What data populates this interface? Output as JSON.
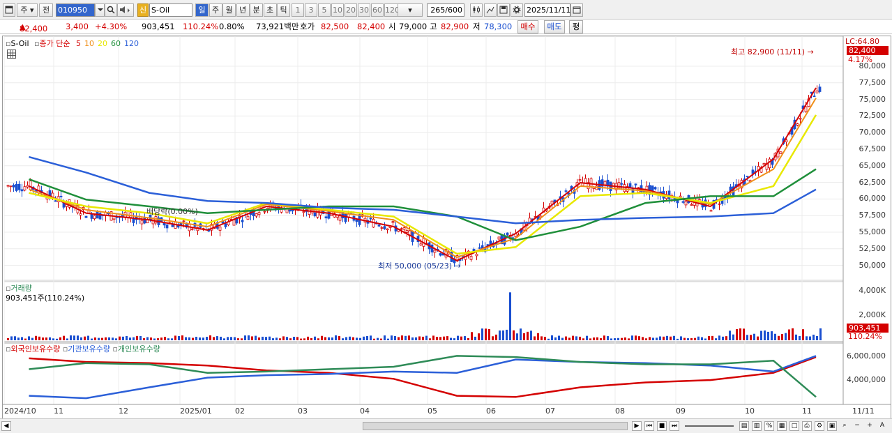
{
  "toolbar": {
    "period_type": "주",
    "prev_label": "전",
    "code": "010950",
    "tag_new": "신",
    "stock_name": "S-Oil",
    "periods": [
      "일",
      "주",
      "월",
      "년",
      "분",
      "초",
      "틱"
    ],
    "active_period": "일",
    "intervals": [
      "1",
      "3",
      "5",
      "10",
      "20",
      "30",
      "60",
      "120"
    ],
    "count": "265",
    "count_max": "/600",
    "date": "2025/11/11"
  },
  "quote": {
    "price": "82,400",
    "change": "3,400",
    "change_pct": "+4.30%",
    "volume": "903,451",
    "volume_ratio": "110.24%",
    "turnover": "0.80%",
    "amount": "73,921백만",
    "bid_label": "호가",
    "bid1": "82,500",
    "bid2": "82,400",
    "open_label": "시",
    "open": "79,000",
    "high_label": "고",
    "high": "82,900",
    "low_label": "저",
    "low": "78,300",
    "buy": "매수",
    "sell": "매도",
    "eval": "평"
  },
  "legend": {
    "name": "S-Oil",
    "close_label": "종가 단순",
    "ma": [
      "5",
      "10",
      "20",
      "60",
      "120"
    ],
    "ma_colors": [
      "#d40000",
      "#f0901a",
      "#e8e800",
      "#1f8f3a",
      "#2b5fd8"
    ]
  },
  "annotations": {
    "high_note": "최고 82,900 (11/11)",
    "low_note": "최저 50,000 (05/23)",
    "dividend_note": "배당락(0.00%)",
    "lc": "LC:64.80",
    "last_price": "82,400",
    "last_pct": "4.17%"
  },
  "volume_panel": {
    "title": "거래량",
    "summary": "903,451주(110.24%)",
    "last": "903,451",
    "last_pct": "110.24%",
    "axis": [
      "4,000K",
      "2,000K"
    ]
  },
  "flow_panel": {
    "labels": [
      "외국인보유수량",
      "기관보유수량",
      "개인보유수량"
    ],
    "colors": [
      "#d40000",
      "#2b5fd8",
      "#2e8b57"
    ],
    "axis": [
      "6,000,000",
      "4,000,000"
    ]
  },
  "price_axis": [
    "80,000",
    "77,500",
    "75,000",
    "72,500",
    "70,000",
    "67,500",
    "65,000",
    "62,500",
    "60,000",
    "57,500",
    "55,000",
    "52,500",
    "50,000"
  ],
  "x_axis": [
    "2024/10",
    "11",
    "12",
    "2025/01",
    "02",
    "03",
    "04",
    "05",
    "06",
    "07",
    "08",
    "09",
    "10",
    "11",
    "11/11"
  ],
  "chart_data": {
    "type": "line",
    "title": "S-Oil",
    "ylim": [
      49000,
      84000
    ],
    "x": [
      "2024/10",
      "11",
      "12",
      "2025/01",
      "02",
      "03",
      "04",
      "05",
      "06",
      "07",
      "08",
      "09",
      "10",
      "11"
    ],
    "series": [
      {
        "name": "5",
        "values": [
          62500,
          58500,
          57500,
          56000,
          59500,
          58500,
          56500,
          51500,
          55500,
          63000,
          62000,
          59500,
          66500,
          77000
        ]
      },
      {
        "name": "10",
        "values": [
          62000,
          59000,
          57800,
          56500,
          59800,
          58800,
          57500,
          52000,
          54800,
          62500,
          61800,
          59800,
          65000,
          75500
        ]
      },
      {
        "name": "20",
        "values": [
          61500,
          59500,
          58500,
          57000,
          60000,
          59000,
          58000,
          52500,
          53500,
          61000,
          61500,
          60000,
          62500,
          73000
        ]
      },
      {
        "name": "60",
        "values": [
          63500,
          60500,
          59500,
          58500,
          59000,
          59500,
          59500,
          58000,
          54500,
          56500,
          60000,
          61000,
          61000,
          65000
        ]
      },
      {
        "name": "120",
        "values": [
          66800,
          64500,
          61500,
          60300,
          60000,
          59300,
          59000,
          58000,
          57000,
          57500,
          57800,
          58000,
          58500,
          62000
        ]
      }
    ],
    "volume_ylim": [
      0,
      4200
    ],
    "flow": [
      {
        "name": "외국인보유수량",
        "values": [
          6200000,
          5900000,
          5800000,
          5600000,
          5200000,
          5000000,
          4500000,
          3100000,
          3000000,
          3800000,
          4200000,
          4400000,
          5000000,
          6300000
        ]
      },
      {
        "name": "기관보유수량",
        "values": [
          3100000,
          2900000,
          3800000,
          4600000,
          4800000,
          4900000,
          5100000,
          5000000,
          6100000,
          5900000,
          5800000,
          5600000,
          5100000,
          6400000
        ]
      },
      {
        "name": "개인보유수량",
        "values": [
          5300000,
          5800000,
          5700000,
          5000000,
          5100000,
          5300000,
          5500000,
          6400000,
          6300000,
          5900000,
          5700000,
          5700000,
          6000000,
          3000000
        ]
      }
    ]
  }
}
